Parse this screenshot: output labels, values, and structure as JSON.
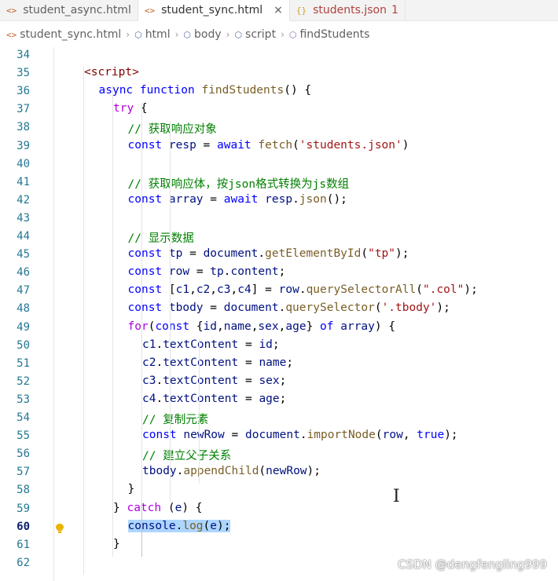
{
  "tabs": [
    {
      "label": "student_async.html",
      "icon": "html-file-icon",
      "active": false
    },
    {
      "label": "student_sync.html",
      "icon": "html-file-icon",
      "active": true,
      "close": "×"
    },
    {
      "label": "students.json",
      "icon": "json-file-icon",
      "active": false,
      "problems": "1"
    }
  ],
  "breadcrumb": [
    "student_sync.html",
    "html",
    "body",
    "script",
    "findStudents"
  ],
  "current_line": "60",
  "lines": [
    {
      "n": "34",
      "text": ""
    },
    {
      "n": "35",
      "text": "<script>"
    },
    {
      "n": "36",
      "text": "async function findStudents() {"
    },
    {
      "n": "37",
      "text": "try {"
    },
    {
      "n": "38",
      "text": "// 获取响应对象"
    },
    {
      "n": "39",
      "text": "const resp = await fetch('students.json')"
    },
    {
      "n": "40",
      "text": ""
    },
    {
      "n": "41",
      "text": "// 获取响应体，按json格式转换为js数组"
    },
    {
      "n": "42",
      "text": "const array = await resp.json();"
    },
    {
      "n": "43",
      "text": ""
    },
    {
      "n": "44",
      "text": "// 显示数据"
    },
    {
      "n": "45",
      "text": "const tp = document.getElementById(\"tp\");"
    },
    {
      "n": "46",
      "text": "const row = tp.content;"
    },
    {
      "n": "47",
      "text": "const [c1,c2,c3,c4] = row.querySelectorAll(\".col\");"
    },
    {
      "n": "48",
      "text": "const tbody = document.querySelector('.tbody');"
    },
    {
      "n": "49",
      "text": "for(const {id,name,sex,age} of array) {"
    },
    {
      "n": "50",
      "text": "c1.textContent = id;"
    },
    {
      "n": "51",
      "text": "c2.textContent = name;"
    },
    {
      "n": "52",
      "text": "c3.textContent = sex;"
    },
    {
      "n": "53",
      "text": "c4.textContent = age;"
    },
    {
      "n": "54",
      "text": "// 复制元素"
    },
    {
      "n": "55",
      "text": "const newRow = document.importNode(row, true);"
    },
    {
      "n": "56",
      "text": "// 建立父子关系"
    },
    {
      "n": "57",
      "text": "tbody.appendChild(newRow);"
    },
    {
      "n": "58",
      "text": "}"
    },
    {
      "n": "59",
      "text": "} catch (e) {"
    },
    {
      "n": "60",
      "text": "console.log(e);"
    },
    {
      "n": "61",
      "text": "}"
    },
    {
      "n": "62",
      "text": ""
    }
  ],
  "watermark": "CSDN @dengfengling999",
  "icons": {
    "lightbulb": "lightbulb-icon",
    "text_cursor": "text-cursor-icon"
  }
}
